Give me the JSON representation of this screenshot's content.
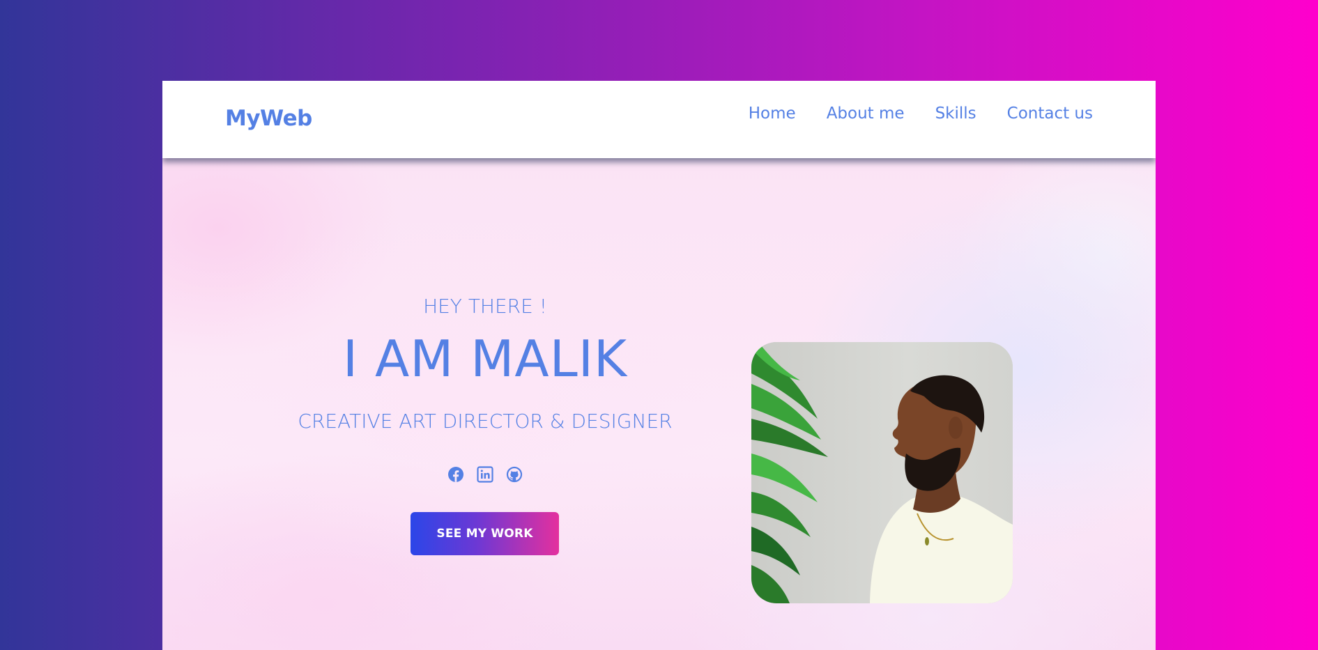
{
  "navbar": {
    "brand": "MyWeb",
    "links": [
      "Home",
      "About me",
      "Skills",
      "Contact us"
    ]
  },
  "hero": {
    "greeting": "HEY THERE !",
    "name": "I AM MALIK",
    "role": "CREATIVE ART DIRECTOR & DESIGNER",
    "cta_label": "SEE MY WORK",
    "socials": [
      "facebook-icon",
      "linkedin-icon",
      "github-icon"
    ]
  },
  "colors": {
    "accent": "#5480e4",
    "background_gradient": [
      "#323599",
      "#ff00cc"
    ],
    "button_gradient": [
      "#2b46e8",
      "#e4309e"
    ]
  }
}
